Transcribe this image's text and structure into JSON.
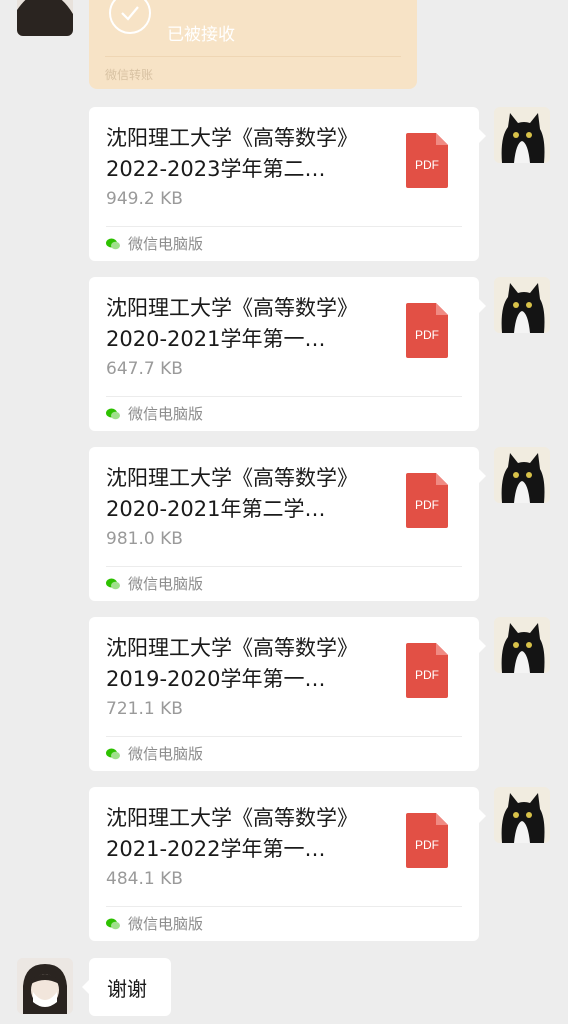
{
  "transfer": {
    "status": "已被接收",
    "footer": "微信转账"
  },
  "files": [
    {
      "title_line1": "沈阳理工大学《高等数学》",
      "title_line2": "2022-2023学年第二…",
      "size": "949.2 KB",
      "source": "微信电脑版",
      "badge": "PDF"
    },
    {
      "title_line1": "沈阳理工大学《高等数学》",
      "title_line2": "2020-2021学年第一…",
      "size": "647.7 KB",
      "source": "微信电脑版",
      "badge": "PDF"
    },
    {
      "title_line1": "沈阳理工大学《高等数学》",
      "title_line2": "2020-2021年第二学…",
      "size": "981.0 KB",
      "source": "微信电脑版",
      "badge": "PDF"
    },
    {
      "title_line1": "沈阳理工大学《高等数学》",
      "title_line2": "2019-2020学年第一…",
      "size": "721.1 KB",
      "source": "微信电脑版",
      "badge": "PDF"
    },
    {
      "title_line1": "沈阳理工大学《高等数学》",
      "title_line2": "2021-2022学年第一…",
      "size": "484.1 KB",
      "source": "微信电脑版",
      "badge": "PDF"
    }
  ],
  "reply": {
    "text": "谢谢"
  },
  "colors": {
    "background": "#ededed",
    "transfer_bubble": "#f7e3c6",
    "pdf_red": "#e25045",
    "wechat_green": "#2dc100"
  },
  "icons": [
    "check-circle-icon",
    "pdf-icon",
    "wechat-icon",
    "cat-avatar",
    "person-avatar"
  ]
}
